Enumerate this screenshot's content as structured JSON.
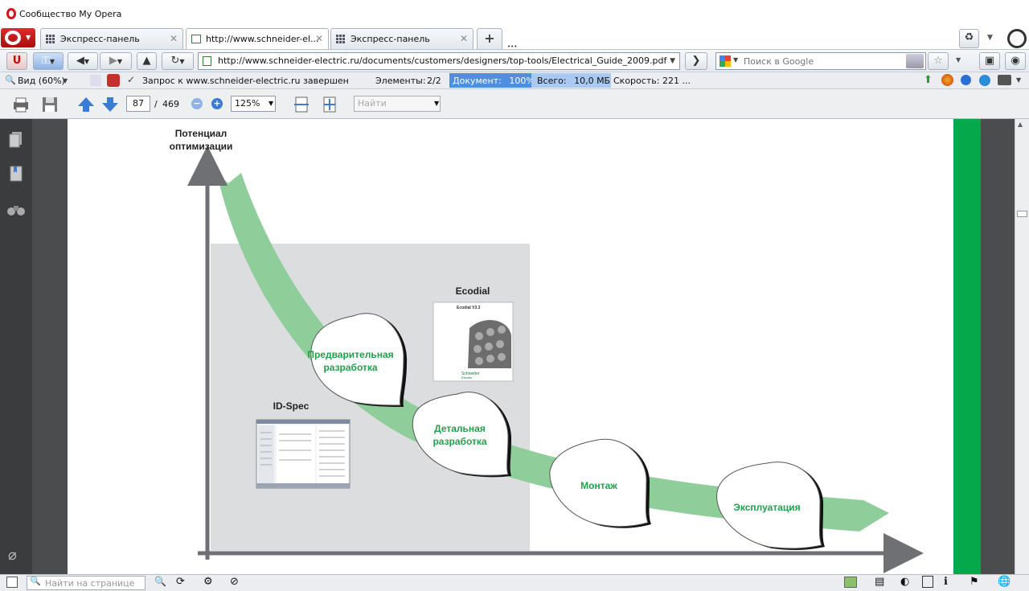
{
  "window": {
    "title": "Сообщество My Opera"
  },
  "tabs": [
    {
      "label": "Экспресс-панель",
      "active": false
    },
    {
      "label": "http://www.schneider-el...",
      "active": true
    },
    {
      "label": "Экспресс-панель",
      "active": false
    }
  ],
  "tabbar": {
    "new_tab_label": "+",
    "dots": "•••"
  },
  "address": {
    "url": "http://www.schneider-electric.ru/documents/customers/designers/top-tools/Electrical_Guide_2009.pdf"
  },
  "search": {
    "placeholder": "Поиск в Google"
  },
  "infobar": {
    "view": "Вид (60%)",
    "status": "Запрос к www.schneider-electric.ru завершен",
    "elements_label": "Элементы:",
    "elements_value": "2/2",
    "document_label": "Документ:",
    "document_value": "100%",
    "total_label": "Всего:",
    "total_value": "10,0 МБ",
    "speed_label": "Скорость:",
    "speed_value": "221 ..."
  },
  "pdf_toolbar": {
    "current_page": "87",
    "page_sep": "/",
    "total_pages": "469",
    "zoom": "125%",
    "find_placeholder": "Найти"
  },
  "diagram": {
    "y_axis_label_line1": "Потенциал",
    "y_axis_label_line2": "оптимизации",
    "stages": [
      {
        "line1": "Предварительная",
        "line2": "разработка"
      },
      {
        "line1": "Детальная",
        "line2": "разработка"
      },
      {
        "line1": "Монтаж",
        "line2": ""
      },
      {
        "line1": "Эксплуатация",
        "line2": ""
      }
    ],
    "tool1_label": "Ecodial",
    "tool1_box_title": "Ecodial V3.3",
    "tool1_brand_line1": "Schneider",
    "tool1_brand_line2": "Electric",
    "tool2_label": "ID-Spec"
  },
  "colors": {
    "arrow_green": "#8fce9b",
    "stage_text": "#1ea24a",
    "page_green_bar": "#05a94c",
    "highlight_box": "#dcddde"
  },
  "bottom": {
    "find_on_page_placeholder": "Найти на странице"
  }
}
